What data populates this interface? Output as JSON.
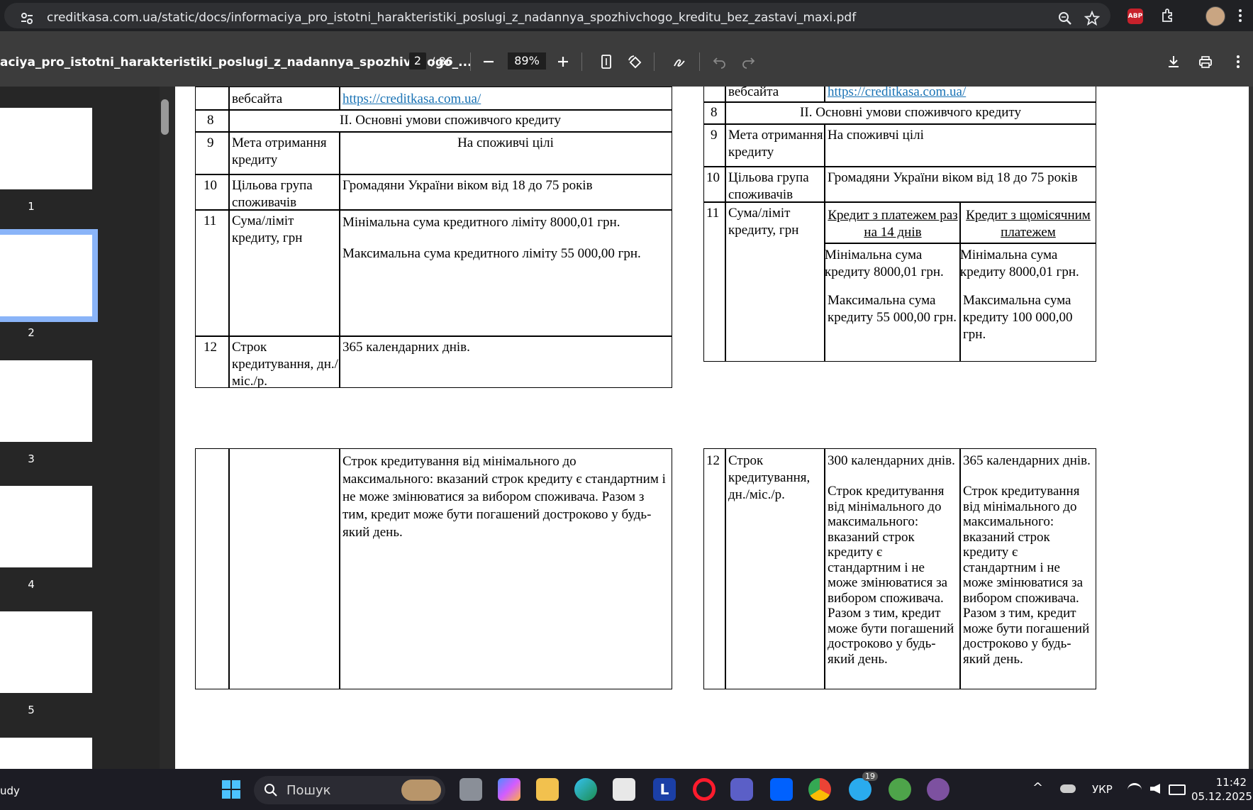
{
  "browser": {
    "url": "creditkasa.com.ua/static/docs/informaciya_pro_istotni_harakteristiki_poslugi_z_nadannya_spozhivchogo_kreditu_bez_zastavi_maxi.pdf",
    "icons": [
      "tune-icon",
      "zoom-icon",
      "bookmark-star-icon",
      "adblock-icon",
      "extensions-icon",
      "profile-avatar",
      "more-icon"
    ],
    "abp_label": "ABP"
  },
  "pdf_toolbar": {
    "title": "aciya_pro_istotni_harakteristiki_poslugi_z_nadannya_spozhivchogo_...",
    "page_current": "2",
    "page_total": "/ 86",
    "zoom": "89%"
  },
  "thumbnails": [
    {
      "label": "1"
    },
    {
      "label": "2"
    },
    {
      "label": "3"
    },
    {
      "label": "4"
    },
    {
      "label": "5"
    }
  ],
  "doc": {
    "left": {
      "website_label": "вебсайта",
      "website_link": "https://creditkasa.com.ua/",
      "row8_num": "8",
      "row8_title": "ІІ. Основні умови споживчого кредиту",
      "row9_num": "9",
      "row9_label": "Мета отримання кредиту",
      "row9_value": "На споживчі цілі",
      "row10_num": "10",
      "row10_label": "Цільова група споживачів",
      "row10_value": "Громадяни України віком від 18 до 75 років",
      "row11_num": "11",
      "row11_label": "Сума/ліміт кредиту, грн",
      "row11_min": "Мінімальна сума кредитного ліміту 8000,01 грн.",
      "row11_max": "Максимальна сума кредитного ліміту 55 000,00 грн.",
      "row12_num": "12",
      "row12_label": "Строк кредитування, дн./міс./р.",
      "row12_value": "365 календарних днів.",
      "row12_cont": "Строк кредитування від мінімального до максимального: вказаний строк кредиту є стандартним і не може змінюватися за вибором споживача. Разом з тим, кредит може бути погашений достроково у будь-який день."
    },
    "right": {
      "website_label": "вебсайта",
      "website_link": "https://creditkasa.com.ua/",
      "row8_num": "8",
      "row8_title": "ІІ. Основні умови споживчого кредиту",
      "row9_num": "9",
      "row9_label": "Мета отримання кредиту",
      "row9_value": "На споживчі цілі",
      "row10_num": "10",
      "row10_label": "Цільова група споживачів",
      "row10_value": "Громадяни України віком від 18 до 75 років",
      "row11_num": "11",
      "row11_label": "Сума/ліміт кредиту, грн",
      "col1_header": "Кредит з платежем раз на 14 днів",
      "col2_header": "Кредит з щомісячним платежем",
      "col1_min": "Мінімальна сума кредиту 8000,01 грн.",
      "col1_max": "Максимальна сума кредиту 55 000,00 грн.",
      "col2_min": "Мінімальна сума кредиту 8000,01 грн.",
      "col2_max": "Максимальна сума кредиту 100 000,00 грн.",
      "row12_num": "12",
      "row12_label": "Строк кредитування, дн./міс./р.",
      "col1_days": "300 календарних днів.",
      "col2_days": "365 календарних днів.",
      "col_term_text": "Строк кредитування від мінімального до максимального: вказаний строк кредиту є стандартним і не може змінюватися за вибором споживача. Разом з тим, кредит може бути погашений достроково у будь-який день."
    }
  },
  "taskbar": {
    "left_text": "udy",
    "search_label": "Пошук",
    "language": "УКР",
    "time": "11:42",
    "date": "05.12.2025",
    "telegram_badge": "19",
    "apps": [
      "start-icon",
      "files-icon",
      "copilot-icon",
      "file-explorer-icon",
      "edge-icon",
      "store-icon",
      "l-app-icon",
      "opera-icon",
      "teams-icon",
      "dropbox-icon",
      "chrome-icon",
      "telegram-icon",
      "utorrent-icon",
      "viber-icon"
    ]
  }
}
